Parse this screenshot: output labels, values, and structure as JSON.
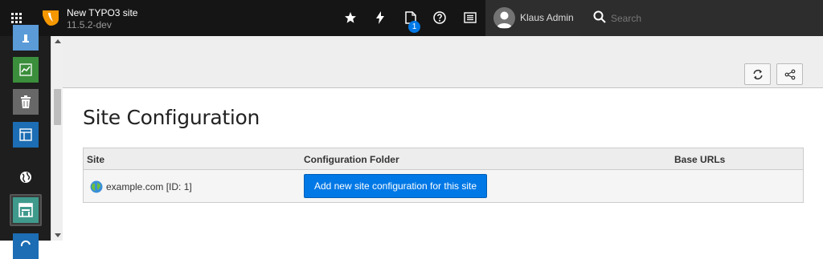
{
  "topbar": {
    "site_title": "New TYPO3 site",
    "site_version": "11.5.2-dev",
    "opendocs_count": "1",
    "user_name": "Klaus Admin",
    "search_placeholder": "Search"
  },
  "sidebar": {
    "modules": [
      {
        "icon": "info-icon",
        "color": "#5a9bd8"
      },
      {
        "icon": "chart-icon",
        "color": "#3b8e3b"
      },
      {
        "icon": "trash-icon",
        "color": "#686868"
      },
      {
        "icon": "layout-icon",
        "color": "#1c6db3"
      },
      {
        "icon": "globe-icon",
        "color": "#1e1e1e"
      },
      {
        "icon": "sites-icon",
        "color": "#3f9a8c",
        "active": true
      },
      {
        "icon": "refresh-icon",
        "color": "#1c6db3"
      }
    ]
  },
  "main": {
    "title": "Site Configuration",
    "table": {
      "headers": [
        "Site",
        "Configuration Folder",
        "Base URLs"
      ],
      "rows": [
        {
          "site": "example.com [ID: 1]",
          "action": "Add new site configuration for this site",
          "base_urls": ""
        }
      ]
    }
  },
  "colors": {
    "topbar_bg": "#151515",
    "accent": "#0078e6",
    "typo3_orange": "#f49700"
  }
}
